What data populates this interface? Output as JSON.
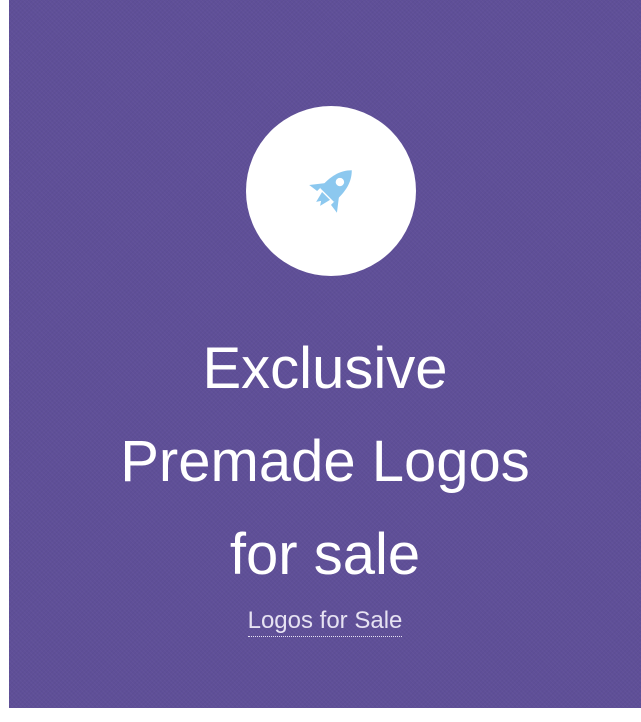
{
  "card": {
    "background_color": "#5f4f98",
    "icon": {
      "name": "rocket-icon",
      "color": "#8cc8ef",
      "circle_color": "#ffffff"
    },
    "headline_lines": [
      "Exclusive",
      "Premade Logos",
      "for sale"
    ],
    "link_label": "Logos for Sale"
  }
}
